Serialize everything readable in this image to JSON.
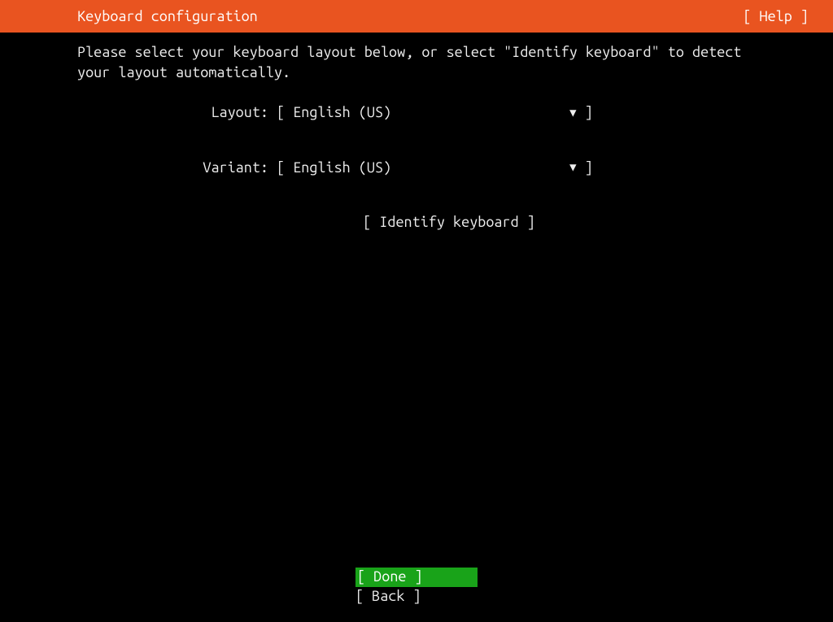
{
  "header": {
    "title": "Keyboard configuration",
    "help": "[ Help ]"
  },
  "instructions": "Please select your keyboard layout below, or select \"Identify keyboard\" to detect your layout automatically.",
  "form": {
    "layout_label": "Layout:",
    "layout_value": "English (US)",
    "variant_label": "Variant:",
    "variant_value": "English (US)"
  },
  "identify_button": "[ Identify keyboard ]",
  "footer": {
    "done_full": "[ Done       ]",
    "back_full": "[ Back       ]"
  }
}
